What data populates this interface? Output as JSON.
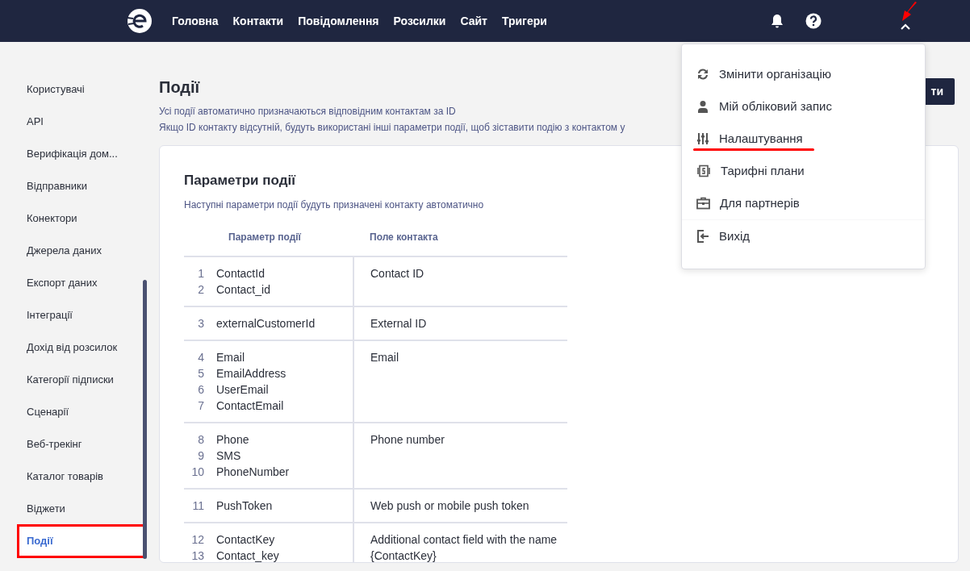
{
  "nav": {
    "items": [
      "Головна",
      "Контакти",
      "Повідомлення",
      "Розсилки",
      "Сайт",
      "Тригери"
    ]
  },
  "sidebar": {
    "items": [
      {
        "label": "Користувачі",
        "selected": false,
        "annotated": false
      },
      {
        "label": "API",
        "selected": false,
        "annotated": false
      },
      {
        "label": "Верифікація дом...",
        "selected": false,
        "annotated": false
      },
      {
        "label": "Відправники",
        "selected": false,
        "annotated": false
      },
      {
        "label": "Конектори",
        "selected": false,
        "annotated": false
      },
      {
        "label": "Джерела даних",
        "selected": false,
        "annotated": false
      },
      {
        "label": "Експорт даних",
        "selected": false,
        "annotated": false
      },
      {
        "label": "Інтеграції",
        "selected": false,
        "annotated": false
      },
      {
        "label": "Дохід від розсилок",
        "selected": false,
        "annotated": false
      },
      {
        "label": "Категорії підписки",
        "selected": false,
        "annotated": false
      },
      {
        "label": "Сценарії",
        "selected": false,
        "annotated": false
      },
      {
        "label": "Веб-трекінг",
        "selected": false,
        "annotated": false
      },
      {
        "label": "Каталог товарів",
        "selected": false,
        "annotated": false
      },
      {
        "label": "Віджети",
        "selected": false,
        "annotated": false
      },
      {
        "label": "Події",
        "selected": true,
        "annotated": true
      }
    ]
  },
  "page": {
    "title": "Події",
    "description": [
      "Усі події автоматично призначаються відповідним контактам за ID",
      "Якщо ID контакту відсутній, будуть використані інші параметри події, щоб зіставити подію з контактом у"
    ],
    "button": "ти"
  },
  "card": {
    "title": "Параметри події",
    "subtitle": "Наступні параметри події будуть призначені контакту автоматично",
    "columns": [
      "Параметр події",
      "Поле контакта"
    ],
    "rows": [
      {
        "params": [
          {
            "number": "1",
            "name": "ContactId"
          },
          {
            "number": "2",
            "name": "Contact_id"
          }
        ],
        "field": "Contact ID"
      },
      {
        "params": [
          {
            "number": "3",
            "name": "externalCustomerId"
          }
        ],
        "field": "External ID"
      },
      {
        "params": [
          {
            "number": "4",
            "name": "Email"
          },
          {
            "number": "5",
            "name": "EmailAddress"
          },
          {
            "number": "6",
            "name": "UserEmail"
          },
          {
            "number": "7",
            "name": "ContactEmail"
          }
        ],
        "field": "Email"
      },
      {
        "params": [
          {
            "number": "8",
            "name": "Phone"
          },
          {
            "number": "9",
            "name": "SMS"
          },
          {
            "number": "10",
            "name": "PhoneNumber"
          }
        ],
        "field": "Phone number"
      },
      {
        "params": [
          {
            "number": "11",
            "name": "PushToken"
          }
        ],
        "field": "Web push or mobile push token"
      },
      {
        "params": [
          {
            "number": "12",
            "name": "ContactKey"
          },
          {
            "number": "13",
            "name": "Contact_key"
          }
        ],
        "field": "Additional contact field with the name {ContactKey}"
      }
    ]
  },
  "user_menu": {
    "annotated": true,
    "items": [
      {
        "label": "Змінити організацію",
        "annotated": false
      },
      {
        "label": "Мій обліковий запис",
        "annotated": false
      },
      {
        "label": "Налаштування",
        "annotated": true
      },
      {
        "label": "Тарифні плани",
        "annotated": false
      },
      {
        "label": "Для партнерів",
        "annotated": false
      },
      {
        "label": "Вихід",
        "annotated": false
      }
    ]
  }
}
